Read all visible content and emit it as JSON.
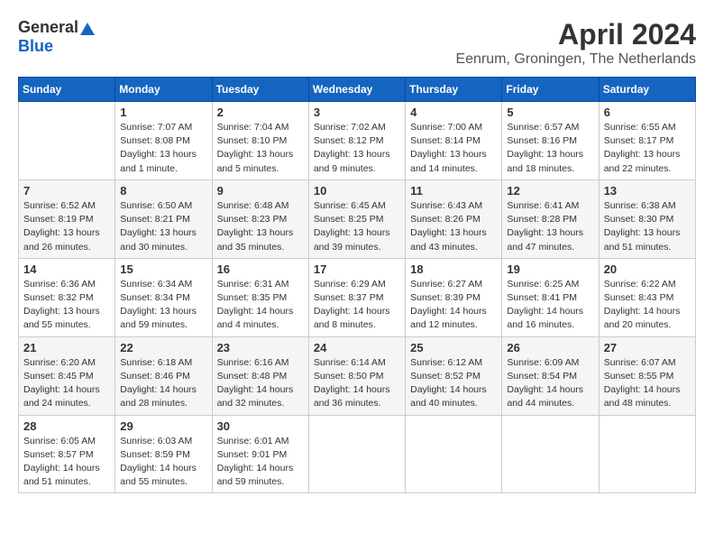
{
  "header": {
    "logo_general": "General",
    "logo_blue": "Blue",
    "month_title": "April 2024",
    "location": "Eenrum, Groningen, The Netherlands"
  },
  "days_of_week": [
    "Sunday",
    "Monday",
    "Tuesday",
    "Wednesday",
    "Thursday",
    "Friday",
    "Saturday"
  ],
  "weeks": [
    [
      {
        "day": "",
        "sunrise": "",
        "sunset": "",
        "daylight": ""
      },
      {
        "day": "1",
        "sunrise": "7:07 AM",
        "sunset": "8:08 PM",
        "daylight": "13 hours and 1 minute."
      },
      {
        "day": "2",
        "sunrise": "7:04 AM",
        "sunset": "8:10 PM",
        "daylight": "13 hours and 5 minutes."
      },
      {
        "day": "3",
        "sunrise": "7:02 AM",
        "sunset": "8:12 PM",
        "daylight": "13 hours and 9 minutes."
      },
      {
        "day": "4",
        "sunrise": "7:00 AM",
        "sunset": "8:14 PM",
        "daylight": "13 hours and 14 minutes."
      },
      {
        "day": "5",
        "sunrise": "6:57 AM",
        "sunset": "8:16 PM",
        "daylight": "13 hours and 18 minutes."
      },
      {
        "day": "6",
        "sunrise": "6:55 AM",
        "sunset": "8:17 PM",
        "daylight": "13 hours and 22 minutes."
      }
    ],
    [
      {
        "day": "7",
        "sunrise": "6:52 AM",
        "sunset": "8:19 PM",
        "daylight": "13 hours and 26 minutes."
      },
      {
        "day": "8",
        "sunrise": "6:50 AM",
        "sunset": "8:21 PM",
        "daylight": "13 hours and 30 minutes."
      },
      {
        "day": "9",
        "sunrise": "6:48 AM",
        "sunset": "8:23 PM",
        "daylight": "13 hours and 35 minutes."
      },
      {
        "day": "10",
        "sunrise": "6:45 AM",
        "sunset": "8:25 PM",
        "daylight": "13 hours and 39 minutes."
      },
      {
        "day": "11",
        "sunrise": "6:43 AM",
        "sunset": "8:26 PM",
        "daylight": "13 hours and 43 minutes."
      },
      {
        "day": "12",
        "sunrise": "6:41 AM",
        "sunset": "8:28 PM",
        "daylight": "13 hours and 47 minutes."
      },
      {
        "day": "13",
        "sunrise": "6:38 AM",
        "sunset": "8:30 PM",
        "daylight": "13 hours and 51 minutes."
      }
    ],
    [
      {
        "day": "14",
        "sunrise": "6:36 AM",
        "sunset": "8:32 PM",
        "daylight": "13 hours and 55 minutes."
      },
      {
        "day": "15",
        "sunrise": "6:34 AM",
        "sunset": "8:34 PM",
        "daylight": "13 hours and 59 minutes."
      },
      {
        "day": "16",
        "sunrise": "6:31 AM",
        "sunset": "8:35 PM",
        "daylight": "14 hours and 4 minutes."
      },
      {
        "day": "17",
        "sunrise": "6:29 AM",
        "sunset": "8:37 PM",
        "daylight": "14 hours and 8 minutes."
      },
      {
        "day": "18",
        "sunrise": "6:27 AM",
        "sunset": "8:39 PM",
        "daylight": "14 hours and 12 minutes."
      },
      {
        "day": "19",
        "sunrise": "6:25 AM",
        "sunset": "8:41 PM",
        "daylight": "14 hours and 16 minutes."
      },
      {
        "day": "20",
        "sunrise": "6:22 AM",
        "sunset": "8:43 PM",
        "daylight": "14 hours and 20 minutes."
      }
    ],
    [
      {
        "day": "21",
        "sunrise": "6:20 AM",
        "sunset": "8:45 PM",
        "daylight": "14 hours and 24 minutes."
      },
      {
        "day": "22",
        "sunrise": "6:18 AM",
        "sunset": "8:46 PM",
        "daylight": "14 hours and 28 minutes."
      },
      {
        "day": "23",
        "sunrise": "6:16 AM",
        "sunset": "8:48 PM",
        "daylight": "14 hours and 32 minutes."
      },
      {
        "day": "24",
        "sunrise": "6:14 AM",
        "sunset": "8:50 PM",
        "daylight": "14 hours and 36 minutes."
      },
      {
        "day": "25",
        "sunrise": "6:12 AM",
        "sunset": "8:52 PM",
        "daylight": "14 hours and 40 minutes."
      },
      {
        "day": "26",
        "sunrise": "6:09 AM",
        "sunset": "8:54 PM",
        "daylight": "14 hours and 44 minutes."
      },
      {
        "day": "27",
        "sunrise": "6:07 AM",
        "sunset": "8:55 PM",
        "daylight": "14 hours and 48 minutes."
      }
    ],
    [
      {
        "day": "28",
        "sunrise": "6:05 AM",
        "sunset": "8:57 PM",
        "daylight": "14 hours and 51 minutes."
      },
      {
        "day": "29",
        "sunrise": "6:03 AM",
        "sunset": "8:59 PM",
        "daylight": "14 hours and 55 minutes."
      },
      {
        "day": "30",
        "sunrise": "6:01 AM",
        "sunset": "9:01 PM",
        "daylight": "14 hours and 59 minutes."
      },
      {
        "day": "",
        "sunrise": "",
        "sunset": "",
        "daylight": ""
      },
      {
        "day": "",
        "sunrise": "",
        "sunset": "",
        "daylight": ""
      },
      {
        "day": "",
        "sunrise": "",
        "sunset": "",
        "daylight": ""
      },
      {
        "day": "",
        "sunrise": "",
        "sunset": "",
        "daylight": ""
      }
    ]
  ]
}
